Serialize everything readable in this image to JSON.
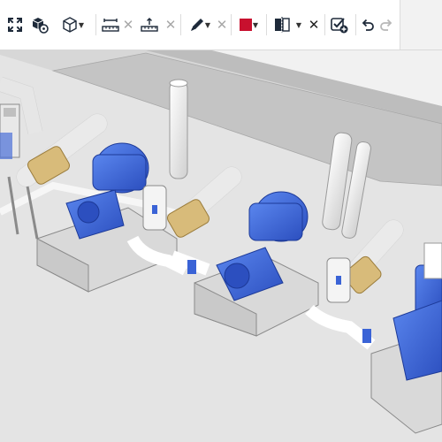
{
  "toolbar": {
    "buttons": [
      {
        "name": "fit-view",
        "icon": "fit-to-screen-icon"
      },
      {
        "name": "cube-gear",
        "icon": "cube-settings-icon"
      },
      {
        "name": "view-cube",
        "icon": "cube-outline-icon",
        "has_dropdown": true
      },
      {
        "name": "measure-distance",
        "icon": "ruler-distance-icon"
      },
      {
        "name": "measure-clear-1",
        "icon": "clear-x-icon"
      },
      {
        "name": "measure-elevation",
        "icon": "ruler-elevation-icon"
      },
      {
        "name": "measure-clear-2",
        "icon": "clear-x-icon"
      },
      {
        "name": "markup-pen",
        "icon": "pen-icon",
        "has_dropdown": true
      },
      {
        "name": "markup-clear",
        "icon": "clear-x-icon"
      },
      {
        "name": "color",
        "icon": "color-swatch-icon",
        "has_dropdown": true
      },
      {
        "name": "section",
        "icon": "section-plane-icon",
        "has_dropdown": true
      },
      {
        "name": "section-clear",
        "icon": "clear-x-icon"
      },
      {
        "name": "approve",
        "icon": "checklist-add-icon"
      },
      {
        "name": "undo",
        "icon": "undo-icon"
      },
      {
        "name": "redo",
        "icon": "redo-icon",
        "disabled": true
      }
    ],
    "accent_color": "#c8102e"
  },
  "scene": {
    "description_icon": "3d-model-viewport",
    "pump_color": "#3a63d6",
    "flange_color": "#d8bb7a"
  }
}
